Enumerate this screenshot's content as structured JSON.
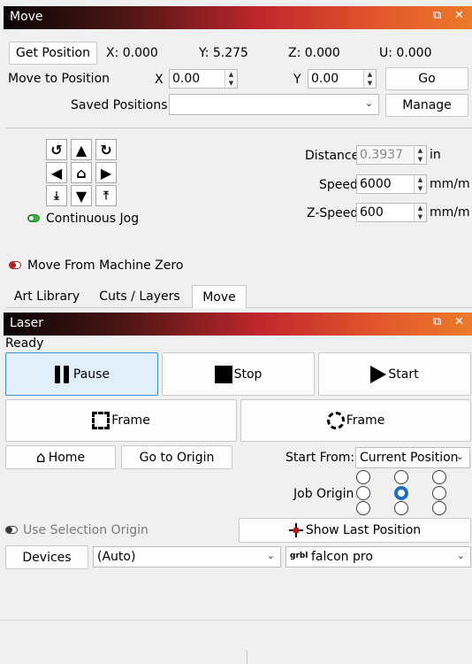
{
  "move_panel": {
    "title": "Move",
    "restore_icon": "restore-icon",
    "close_icon": "close-icon",
    "get_position_label": "Get Position",
    "x_readout": "X: 0.000",
    "y_readout": "Y: 5.275",
    "z_readout": "Z: 0.000",
    "u_readout": "U: 0.000",
    "move_to_label": "Move to Position",
    "x_label": "X",
    "x_value": "0.00",
    "y_label": "Y",
    "y_value": "0.00",
    "go_label": "Go",
    "saved_positions_label": "Saved Positions:",
    "saved_positions_value": "",
    "manage_label": "Manage",
    "jog_icons": [
      "rotate-ccw-icon",
      "arrow-up-icon",
      "rotate-cw-icon",
      "arrow-left-icon",
      "home-icon",
      "arrow-right-icon",
      "z-down-icon",
      "arrow-down-icon",
      "z-up-icon"
    ],
    "continuous_jog_label": "Continuous Jog",
    "continuous_jog_on": true,
    "distance_label": "Distance",
    "distance_value": "0.3937",
    "distance_unit": "in",
    "speed_label": "Speed",
    "speed_value": "6000",
    "speed_unit": "mm/m",
    "zspeed_label": "Z-Speed",
    "zspeed_value": "600",
    "zspeed_unit": "mm/m",
    "machine_zero_label": "Move From Machine Zero",
    "machine_zero_on": false
  },
  "tabs": [
    {
      "label": "Art Library",
      "active": false
    },
    {
      "label": "Cuts / Layers",
      "active": false
    },
    {
      "label": "Move",
      "active": true
    }
  ],
  "laser_panel": {
    "title": "Laser",
    "status": "Ready",
    "pause_label": "Pause",
    "stop_label": "Stop",
    "start_label": "Start",
    "frame_rect_label": "Frame",
    "frame_circle_label": "Frame",
    "home_label": "Home",
    "go_origin_label": "Go to Origin",
    "start_from_label": "Start From:",
    "start_from_value": "Current Position",
    "job_origin_label": "Job Origin",
    "job_origin_selected": "center",
    "use_selection_label": "Use Selection Origin",
    "use_selection_on": false,
    "show_last_label": "Show Last Position",
    "devices_label": "Devices",
    "port_value": "(Auto)",
    "device_badge": "grbl",
    "device_value": "falcon pro"
  },
  "colors": {
    "accent_blue": "#1f6fc0",
    "toggle_on": "#3cb043",
    "toggle_off": "#b02020",
    "pressed_bg": "#e1effa"
  }
}
